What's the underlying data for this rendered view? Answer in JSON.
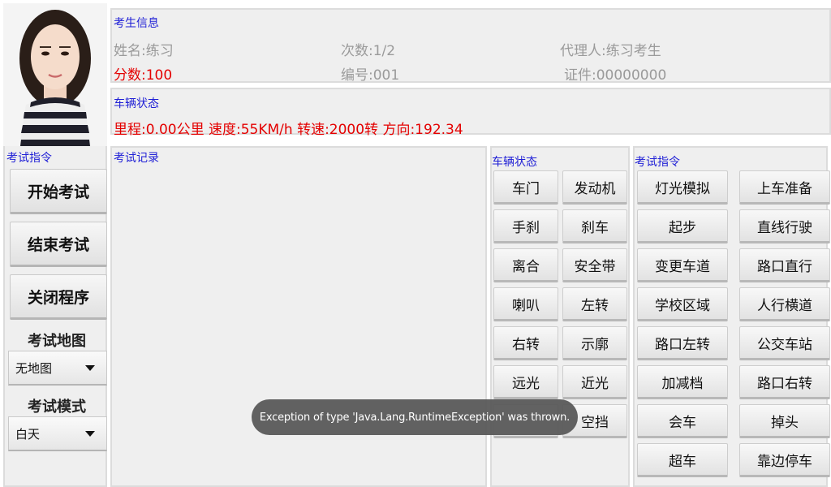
{
  "left": {
    "title": "考试指令",
    "start_button": "开始考试",
    "end_button": "结束考试",
    "close_button": "关闭程序",
    "map_label": "考试地图",
    "map_value": "无地图",
    "mode_label": "考试模式",
    "mode_value": "白天"
  },
  "student_info": {
    "title": "考生信息",
    "name": "姓名:练习",
    "count": "次数:1/2",
    "agent": "代理人:练习考生",
    "score": "分数:100",
    "number": "编号:001",
    "id": "证件:00000000"
  },
  "vehicle": {
    "title": "车辆状态",
    "summary": "里程:0.00公里 速度:55KM/h 转速:2000转 方向:192.34"
  },
  "record": {
    "title": "考试记录"
  },
  "vehicle_status": {
    "title": "车辆状态",
    "buttons": [
      "车门",
      "发动机",
      "手刹",
      "刹车",
      "离合",
      "安全带",
      "喇叭",
      "左转",
      "右转",
      "示廓",
      "远光",
      "近光",
      "",
      "空挡"
    ]
  },
  "commands": {
    "title": "考试指令",
    "buttons": [
      "灯光模拟",
      "上车准备",
      "起步",
      "直线行驶",
      "变更车道",
      "路口直行",
      "学校区域",
      "人行横道",
      "路口左转",
      "公交车站",
      "加减档",
      "路口右转",
      "会车",
      "掉头",
      "超车",
      "靠边停车"
    ]
  },
  "toast": {
    "message": "Exception of type 'Java.Lang.RuntimeException' was thrown."
  },
  "colors": {
    "title_blue": "#1f1fd6",
    "value_red": "#e40000",
    "grey_text": "#9a9a9a"
  }
}
